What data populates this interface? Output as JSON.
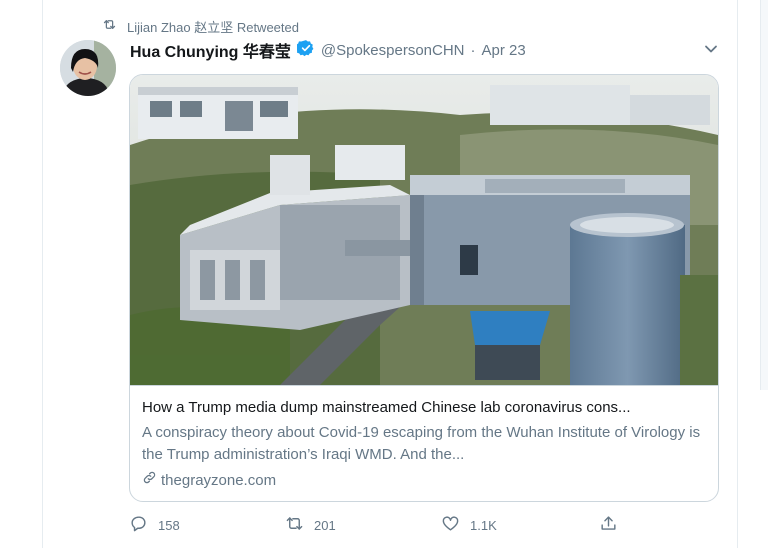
{
  "retweet": {
    "icon": "retweet-icon",
    "text": "Lijian Zhao 赵立坚 Retweeted"
  },
  "tweet": {
    "display_name": "Hua Chunying 华春莹",
    "verified": true,
    "handle": "@SpokespersonCHN",
    "separator": "·",
    "date": "Apr 23"
  },
  "card": {
    "title": "How a Trump media dump mainstreamed Chinese lab coronavirus cons...",
    "description": "A conspiracy theory about Covid-19 escaping from the Wuhan Institute of Virology is the Trump administration’s Iraqi WMD. And the...",
    "link": "thegrayzone.com"
  },
  "actions": {
    "replies": "158",
    "retweets": "201",
    "likes": "1.1K"
  },
  "colors": {
    "muted": "#657786",
    "verified_blue": "#1da1f2",
    "border": "#ccd6dd"
  }
}
